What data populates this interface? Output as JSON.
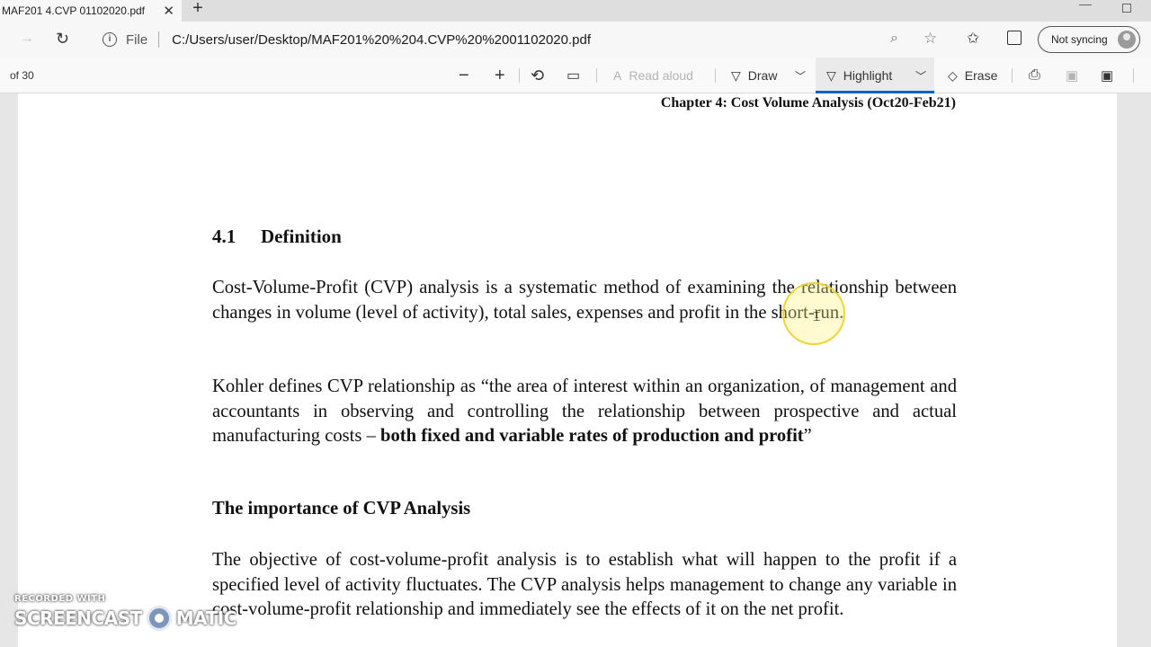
{
  "tab": {
    "title": "MAF201 4.CVP 01102020.pdf",
    "close": "✕",
    "new_tab": "+"
  },
  "address": {
    "protocol_label": "File",
    "url": "C:/Users/user/Desktop/MAF201%20%204.CVP%20%2001102020.pdf",
    "sync_label": "Not syncing"
  },
  "pdf_toolbar": {
    "page_count": "of 30",
    "read_aloud": "Read aloud",
    "draw": "Draw",
    "highlight": "Highlight",
    "erase": "Erase"
  },
  "document": {
    "running_head": "Chapter 4: Cost Volume Analysis (Oct20-Feb21)",
    "section_number": "4.1",
    "section_title": "Definition",
    "para1": "Cost-Volume-Profit (CVP) analysis is a systematic method of examining the relationship between changes in volume (level of activity), total sales, expenses and profit in the short-run.",
    "para2_plain": "Kohler defines CVP relationship as “the area of interest within an organization, of management and accountants in observing and controlling the relationship between prospective and actual manufacturing costs – ",
    "para2_bold": "both fixed and variable rates of production and profit",
    "para2_end": "”",
    "subheading": "The importance of CVP Analysis",
    "para3": "The objective of cost-volume-profit analysis is to establish what will happen to the profit if a specified level of activity fluctuates. The CVP analysis helps management to change any variable in cost-volume-profit relationship and immediately see the effects of it on the net profit."
  },
  "watermark": {
    "line1": "RECORDED WITH",
    "left": "SCREENCAST",
    "right": "MATIC"
  },
  "icons": [
    "close-icon",
    "new-tab-icon",
    "forward-icon",
    "refresh-icon",
    "info-icon",
    "zoom-icon",
    "star-icon",
    "favorites-icon",
    "collections-icon",
    "zoom-out-icon",
    "zoom-in-icon",
    "rotate-icon",
    "fit-page-icon",
    "read-aloud-icon",
    "draw-icon",
    "highlight-icon",
    "erase-icon",
    "print-icon",
    "save-icon",
    "save-as-icon"
  ]
}
